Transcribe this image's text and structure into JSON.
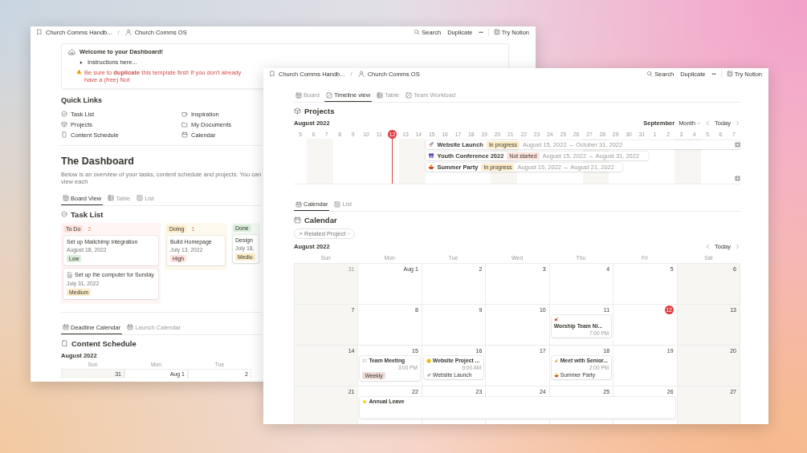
{
  "left_window": {
    "breadcrumb": {
      "items": [
        "Church Comms Handb...",
        "Church Comms OS"
      ],
      "separator": "/"
    },
    "actions": {
      "search": "Search",
      "duplicate": "Duplicate",
      "more": "•••",
      "try": "Try Notion"
    },
    "callout": {
      "title": "Welcome to your Dashboard!",
      "toggle": "Instructions here...",
      "warning": "Be sure to **duplicate** this template first! If you don't already have a (free) Not"
    },
    "quick_links": {
      "title": "Quick Links",
      "items": [
        "Task List",
        "Projects",
        "Content Schedule",
        "Inspiration",
        "My Documents",
        "Calendar"
      ]
    },
    "title": "The Dashboard",
    "description": "Below is an overview of your tasks, content schedule and projects. You can view each",
    "task_tabs": [
      {
        "label": "Board View",
        "selected": true
      },
      {
        "label": "Table",
        "selected": false
      },
      {
        "label": "List",
        "selected": false
      }
    ],
    "task_list": {
      "title": "Task List",
      "columns": [
        {
          "name": "To Do",
          "count": "2",
          "color": "#ffe2dd",
          "cards": [
            {
              "kind": "task",
              "title": "Set up Mailchimp integration",
              "date": "August 18, 2022",
              "priority": "Low",
              "color": "#dbeddb"
            },
            {
              "kind": "page",
              "title": "Set up the computer for Sunday",
              "date": "July 31, 2022",
              "priority": "Medium",
              "color": "#fdecc8"
            }
          ]
        },
        {
          "name": "Doing",
          "count": "1",
          "color": "#fdecc8",
          "cards": [
            {
              "kind": "task",
              "title": "Build Homepage",
              "date": "July 13, 2022",
              "priority": "High",
              "color": "#ffe2dd"
            }
          ]
        },
        {
          "name": "Done",
          "color": "#dbeddb",
          "cards": [
            {
              "kind": "task",
              "title": "Design",
              "date": "July 18,",
              "priority": "Mediu",
              "color": "#fdecc8"
            }
          ]
        }
      ]
    },
    "content_tabs": [
      {
        "label": "Deadline Calendar",
        "selected": true
      },
      {
        "label": "Launch Calendar",
        "selected": false
      }
    ],
    "content_schedule": {
      "title": "Content Schedule",
      "month": "August 2022",
      "weekdays": [
        "Sun",
        "Mon",
        "Tue"
      ],
      "days": [
        {
          "label": "31",
          "outside": true
        },
        {
          "label": "Aug 1",
          "outside": false
        },
        {
          "label": "2",
          "outside": false
        }
      ]
    }
  },
  "right_window": {
    "breadcrumb": {
      "items": [
        "Church Comms Handb...",
        "Church Comms OS"
      ],
      "separator": "/"
    },
    "actions": {
      "search": "Search",
      "duplicate": "Duplicate",
      "more": "•••",
      "try": "Try Notion"
    },
    "tabs": [
      {
        "label": "Board",
        "selected": false
      },
      {
        "label": "Timeline view",
        "selected": true
      },
      {
        "label": "Table",
        "selected": false
      },
      {
        "label": "Team Workload",
        "selected": false
      }
    ],
    "projects": {
      "title": "Projects",
      "month": "August 2022",
      "next_month": "September",
      "scale": "Month",
      "today_button": "Today",
      "days": [
        {
          "label": "5",
          "today": false
        },
        {
          "label": "6",
          "today": false
        },
        {
          "label": "7",
          "today": false
        },
        {
          "label": "8",
          "today": false
        },
        {
          "label": "9",
          "today": false
        },
        {
          "label": "10",
          "today": false
        },
        {
          "label": "11",
          "today": false
        },
        {
          "label": "12",
          "today": true
        },
        {
          "label": "13",
          "today": false
        },
        {
          "label": "14",
          "today": false
        },
        {
          "label": "15",
          "today": false
        },
        {
          "label": "16",
          "today": false
        },
        {
          "label": "17",
          "today": false
        },
        {
          "label": "18",
          "today": false
        },
        {
          "label": "19",
          "today": false
        },
        {
          "label": "20",
          "today": false
        },
        {
          "label": "21",
          "today": false
        },
        {
          "label": "22",
          "today": false
        },
        {
          "label": "23",
          "today": false
        },
        {
          "label": "24",
          "today": false
        },
        {
          "label": "25",
          "today": false
        },
        {
          "label": "26",
          "today": false
        },
        {
          "label": "27",
          "today": false
        },
        {
          "label": "28",
          "today": false
        },
        {
          "label": "29",
          "today": false
        },
        {
          "label": "30",
          "today": false
        },
        {
          "label": "31",
          "today": false
        },
        {
          "label": "1",
          "today": false
        },
        {
          "label": "2",
          "today": false
        },
        {
          "label": "3",
          "today": false
        },
        {
          "label": "4",
          "today": false
        },
        {
          "label": "5",
          "today": false
        },
        {
          "label": "6",
          "today": false
        },
        {
          "label": "7",
          "today": false
        }
      ],
      "items": [
        {
          "name": "Website Launch",
          "status": "In progress",
          "color": "#fdecc8",
          "dates": "August 15, 2022 → October 31, 2022"
        },
        {
          "name": "Youth Conference 2022",
          "status": "Not started",
          "color": "#ffe2dd",
          "dates": "August 15, 2022 → August 31, 2022"
        },
        {
          "name": "Summer Party",
          "status": "In progress",
          "color": "#fdecc8",
          "dates": "August 15, 2022 → August 21, 2022"
        }
      ]
    },
    "calendar_tabs": [
      {
        "label": "Calendar",
        "selected": true
      },
      {
        "label": "List",
        "selected": false
      }
    ],
    "calendar": {
      "title": "Calendar",
      "filter": "Related Project",
      "month": "August 2022",
      "today_button": "Today",
      "weekdays": [
        "Sun",
        "Mon",
        "Tue",
        "Wed",
        "Thu",
        "Fri",
        "Sat"
      ],
      "weeks": [
        {
          "days": [
            {
              "label": "31",
              "outside": true,
              "today": false
            },
            {
              "label": "Aug 1",
              "outside": false,
              "today": false
            },
            {
              "label": "2",
              "outside": false,
              "today": false
            },
            {
              "label": "3",
              "outside": false,
              "today": false
            },
            {
              "label": "4",
              "outside": false,
              "today": false
            },
            {
              "label": "5",
              "outside": false,
              "today": false
            },
            {
              "label": "6",
              "outside": false,
              "today": false
            }
          ]
        },
        {
          "days": [
            {
              "label": "7",
              "outside": false,
              "today": false
            },
            {
              "label": "8",
              "outside": false,
              "today": false
            },
            {
              "label": "9",
              "outside": false,
              "today": false
            },
            {
              "label": "10",
              "outside": false,
              "today": false
            },
            {
              "label": "11",
              "outside": false,
              "today": false,
              "events": [
                {
                  "title": "Worship Team Ni...",
                  "time": "7:00 PM"
                }
              ]
            },
            {
              "label": "12",
              "outside": false,
              "today": true
            },
            {
              "label": "13",
              "outside": false,
              "today": false
            }
          ]
        },
        {
          "days": [
            {
              "label": "14",
              "outside": false,
              "today": false
            },
            {
              "label": "15",
              "outside": false,
              "today": false,
              "events": [
                {
                  "title": "Team Meeting",
                  "time": "3:00 PM",
                  "tag": "Weekly"
                }
              ]
            },
            {
              "label": "16",
              "outside": false,
              "today": false,
              "events": [
                {
                  "title": "Website Project ...",
                  "time": "9:00 AM",
                  "project": "Website Launch"
                }
              ]
            },
            {
              "label": "17",
              "outside": false,
              "today": false
            },
            {
              "label": "18",
              "outside": false,
              "today": false,
              "events": [
                {
                  "title": "Meet with Senior...",
                  "time": "2:00 PM",
                  "project": "Summer Party"
                }
              ]
            },
            {
              "label": "19",
              "outside": false,
              "today": false
            },
            {
              "label": "20",
              "outside": false,
              "today": false
            }
          ]
        },
        {
          "days": [
            {
              "label": "21",
              "outside": false,
              "today": false
            },
            {
              "label": "22",
              "outside": false,
              "today": false,
              "events": [
                {
                  "title": "Annual Leave"
                }
              ]
            },
            {
              "label": "23",
              "outside": false,
              "today": false
            },
            {
              "label": "24",
              "outside": false,
              "today": false
            },
            {
              "label": "25",
              "outside": false,
              "today": false
            },
            {
              "label": "26",
              "outside": false,
              "today": false
            },
            {
              "label": "27",
              "outside": false,
              "today": false
            }
          ]
        }
      ]
    }
  }
}
